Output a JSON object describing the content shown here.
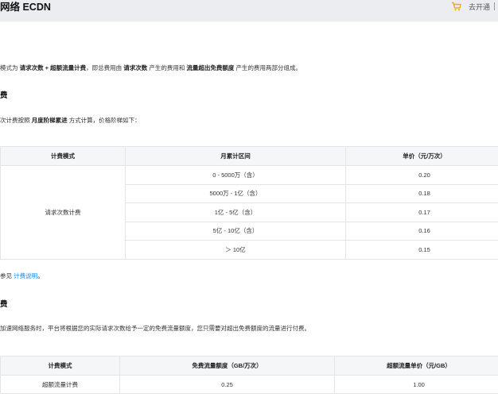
{
  "header": {
    "title": "网络 ECDN",
    "open_label": "去开通",
    "cart_icon": "cart-icon",
    "accent": "#f5a623"
  },
  "intro": {
    "prefix": "模式为",
    "mode": "请求次数 + 超额流量计费",
    "middle": "，即总费用由",
    "part1": "请求次数",
    "middle2": "产生的费用和",
    "part2": "流量超出免费额度",
    "suffix": "产生的费用两部分组成。"
  },
  "section1": {
    "heading": "费",
    "desc_prefix": "次计费按照",
    "desc_bold": "月度阶梯累进",
    "desc_suffix": "方式计算，价格阶梯如下："
  },
  "table1": {
    "headers": [
      "计费模式",
      "月累计区间",
      "单价（元/万次）"
    ],
    "mode": "请求次数计费",
    "rows": [
      {
        "range": "0 - 5000万（含）",
        "price": "0.20"
      },
      {
        "range": "5000万 - 1亿（含）",
        "price": "0.18"
      },
      {
        "range": "1亿 - 5亿（含）",
        "price": "0.17"
      },
      {
        "range": "5亿 - 10亿（含）",
        "price": "0.16"
      },
      {
        "range": "＞ 10亿",
        "price": "0.15"
      }
    ]
  },
  "ref": {
    "prefix": "参见",
    "link": "计费说明",
    "suffix": "。"
  },
  "section2": {
    "heading": "费",
    "desc": "加速网络服务时，平台将根据您的实际请求次数给予一定的免费流量额度，您只需要对超出免费额度的流量进行付费。"
  },
  "table2": {
    "headers": [
      "计费模式",
      "免费流量额度（GB/万次）",
      "超额流量单价（元/GB）"
    ],
    "row": {
      "mode": "超额流量计费",
      "quota": "0.25",
      "price": "1.00"
    }
  }
}
